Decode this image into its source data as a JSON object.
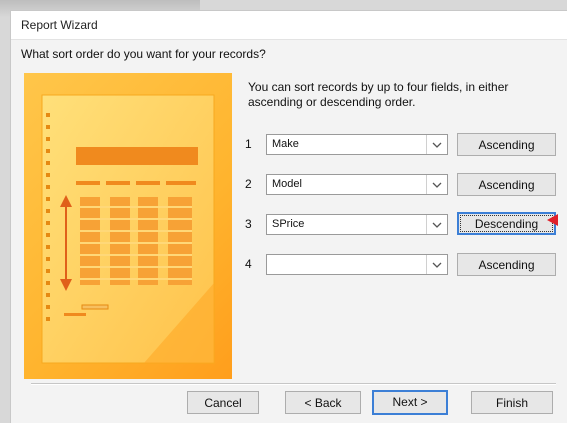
{
  "window": {
    "title": "Report Wizard"
  },
  "question": "What sort order do you want for your records?",
  "intro": "You can sort records by up to four fields, in either ascending or descending order.",
  "sort_rows": [
    {
      "number": "1",
      "field": "Make",
      "order": "Ascending"
    },
    {
      "number": "2",
      "field": "Model",
      "order": "Ascending"
    },
    {
      "number": "3",
      "field": "SPrice",
      "order": "Descending"
    },
    {
      "number": "4",
      "field": "",
      "order": "Ascending"
    }
  ],
  "buttons": {
    "cancel": "Cancel",
    "back": "< Back",
    "next": "Next >",
    "finish": "Finish"
  },
  "colors": {
    "illustration_orange": "#ffb42e",
    "focus_blue": "#3c7fd6",
    "pointer_red": "#e0202a"
  }
}
